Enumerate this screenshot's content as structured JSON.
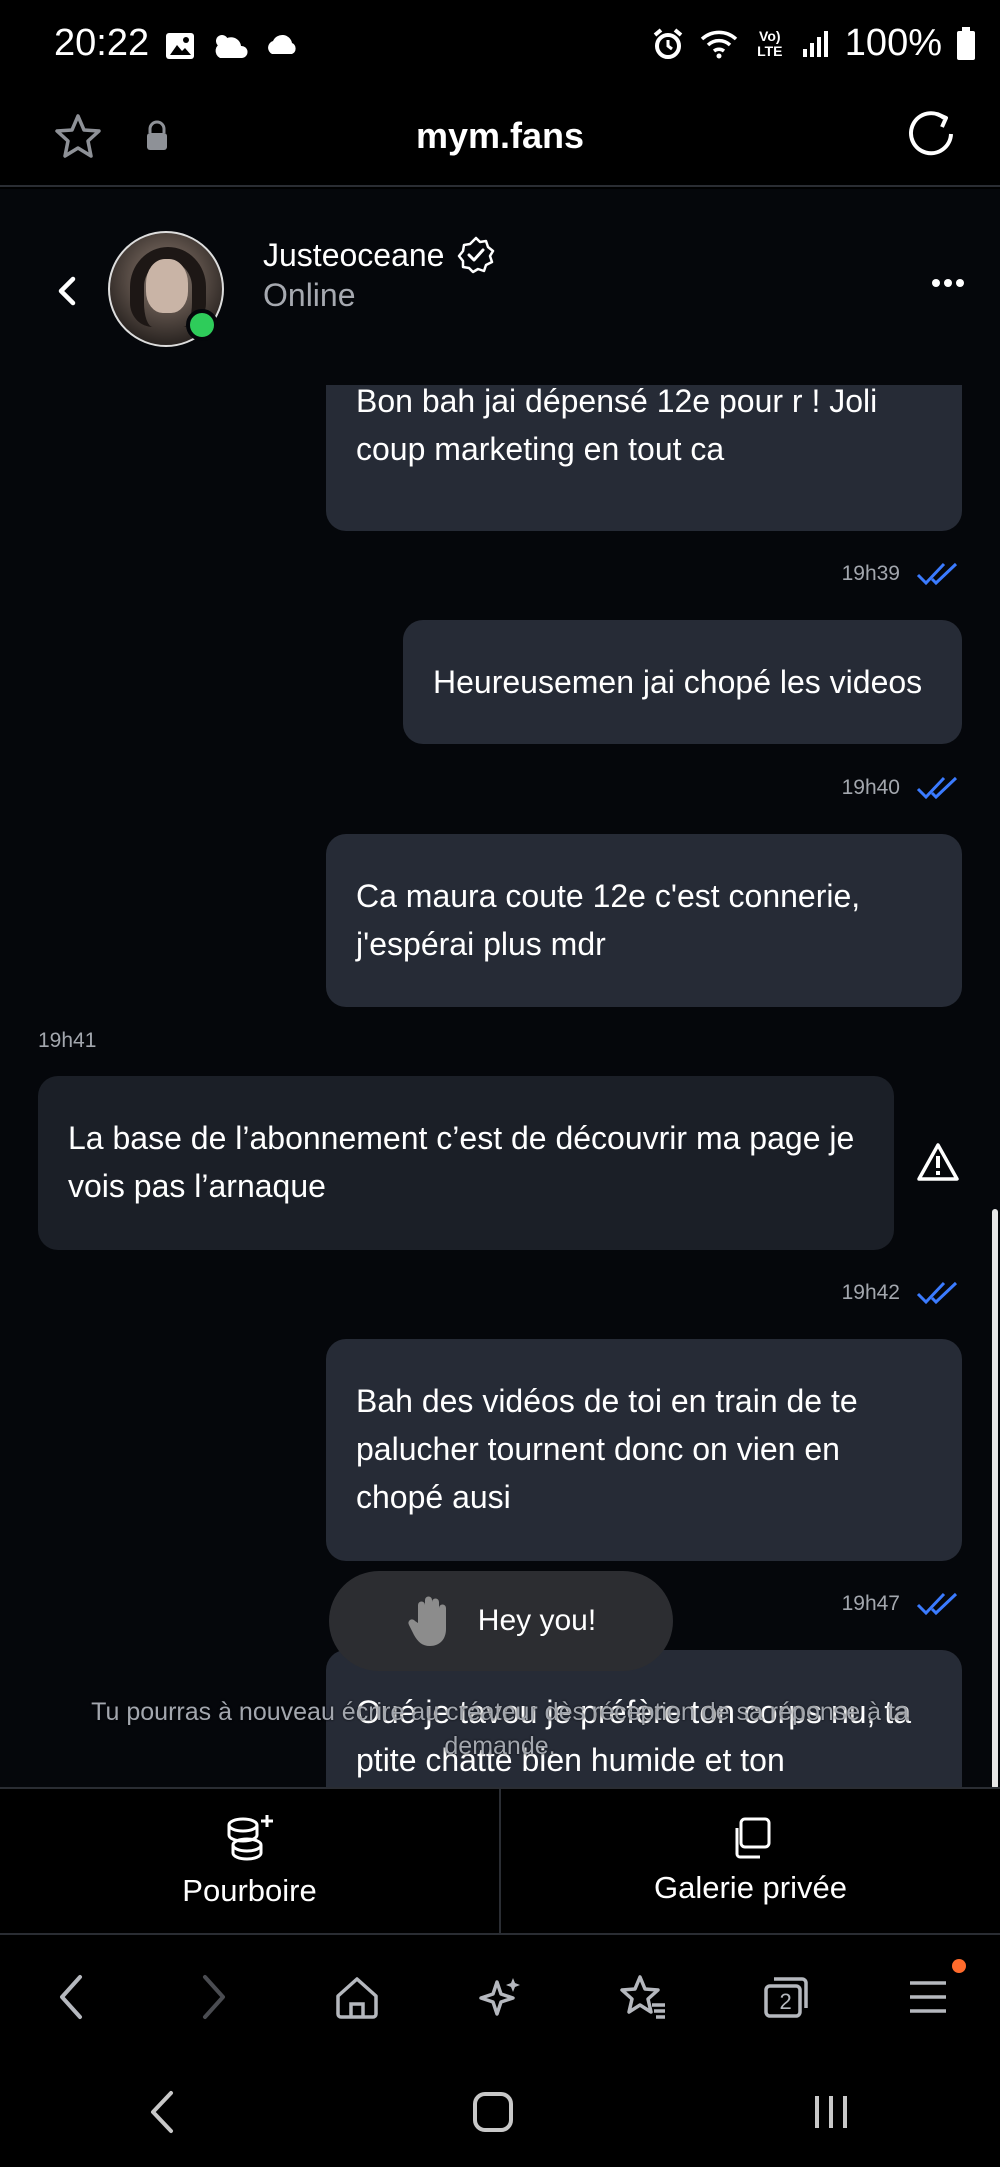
{
  "status_bar": {
    "time": "20:22",
    "battery": "100%",
    "network": "Vo) LTE"
  },
  "browser": {
    "url": "mym.fans"
  },
  "chat_header": {
    "username": "Justeoceane",
    "presence": "Online"
  },
  "messages": [
    {
      "direction": "outgoing",
      "text": "Bon bah jai dépensé 12e pour r ! Joli coup marketing en tout ca",
      "time": "19h39",
      "status": "read"
    },
    {
      "direction": "outgoing",
      "text": "Heureusemen jai chopé les videos",
      "time": "19h40",
      "status": "read"
    },
    {
      "direction": "outgoing",
      "text": "Ca maura coute 12e c'est connerie, j'espérai plus mdr",
      "time": "",
      "status": ""
    },
    {
      "direction": "incoming",
      "text": "La base de l’abonnement c’est de découvrir ma page je vois pas l’arnaque",
      "time": "19h41"
    },
    {
      "direction": "outgoing",
      "text": "Bah des vidéos de toi en train de te palucher tournent donc on vien en chopé ausi",
      "time": "19h42",
      "status": "read"
    },
    {
      "direction": "outgoing",
      "text": "Oué je tavou je préfère ton corps nu, ta ptite chatte bien humide et ton",
      "time": "19h47",
      "status": "read"
    }
  ],
  "toast": {
    "text": "Hey you!",
    "icon": "raised-hand-icon"
  },
  "blocked_note": "Tu pourras à nouveau écrire au créateur dès réception de sa réponse à ta demande.",
  "actions": [
    {
      "label": "Pourboire",
      "icon": "coins-plus-icon"
    },
    {
      "label": "Galerie privée",
      "icon": "gallery-copy-icon"
    }
  ],
  "browser_toolbar": {
    "tab_count": "2"
  },
  "colors": {
    "background": "#05070b",
    "bubble": "#262b36",
    "read_check": "#3b7bff",
    "online": "#2ecc5a",
    "notification": "#ff6b2c"
  }
}
